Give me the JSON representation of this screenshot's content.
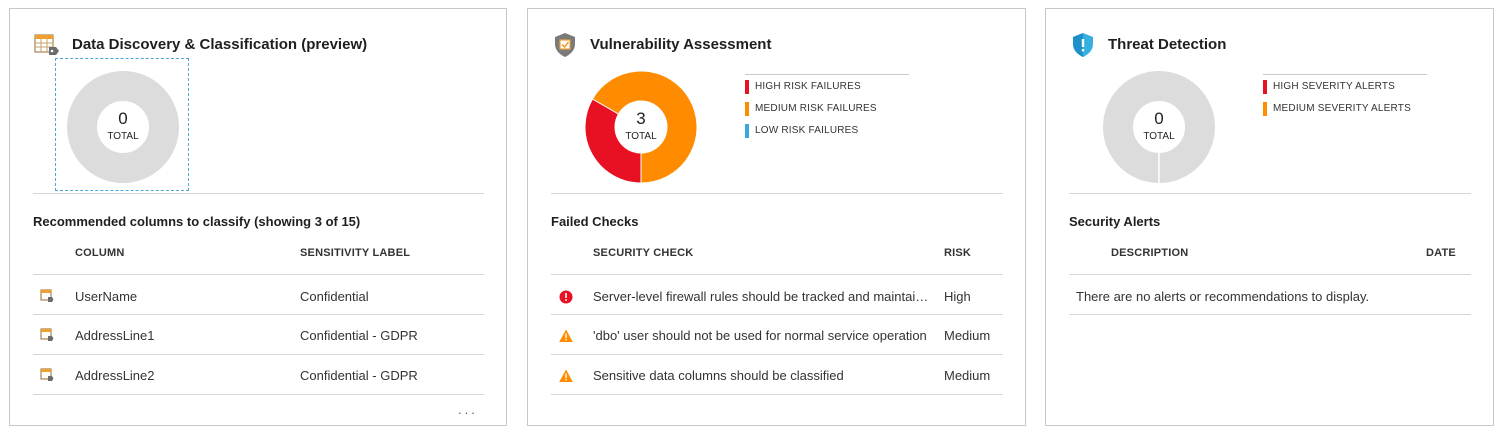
{
  "colors": {
    "high": "#e81123",
    "medium": "#ff8c00",
    "low": "#3aa8e0",
    "empty": "#dcdcdc"
  },
  "classification": {
    "title": "Data Discovery & Classification (preview)",
    "icon": "table-tag-icon",
    "donut": {
      "count": "0",
      "label": "TOTAL"
    },
    "section_title": "Recommended columns to classify (showing 3 of 15)",
    "headers": {
      "column": "COLUMN",
      "label": "SENSITIVITY LABEL"
    },
    "rows": [
      {
        "column": "UserName",
        "label": "Confidential",
        "icon": "column-icon"
      },
      {
        "column": "AddressLine1",
        "label": "Confidential - GDPR",
        "icon": "column-icon"
      },
      {
        "column": "AddressLine2",
        "label": "Confidential - GDPR",
        "icon": "column-icon"
      }
    ],
    "more": "..."
  },
  "vulnerability": {
    "title": "Vulnerability Assessment",
    "icon": "shield-check-icon",
    "donut": {
      "count": "3",
      "label": "TOTAL"
    },
    "chart_data": {
      "type": "pie",
      "categories": [
        "HIGH RISK FAILURES",
        "MEDIUM RISK FAILURES",
        "LOW RISK FAILURES"
      ],
      "values": [
        1,
        2,
        0
      ]
    },
    "legend": [
      {
        "label": "HIGH RISK FAILURES",
        "color": "#e81123"
      },
      {
        "label": "MEDIUM RISK FAILURES",
        "color": "#ff8c00"
      },
      {
        "label": "LOW RISK FAILURES",
        "color": "#3aa8e0"
      }
    ],
    "section_title": "Failed Checks",
    "headers": {
      "check": "SECURITY CHECK",
      "risk": "RISK"
    },
    "rows": [
      {
        "check": "Server-level firewall rules should be tracked and maintained at a strict minimum",
        "risk": "High",
        "icon": "error-icon"
      },
      {
        "check": "'dbo' user should not be used for normal service operation",
        "risk": "Medium",
        "icon": "warning-icon"
      },
      {
        "check": "Sensitive data columns should be classified",
        "risk": "Medium",
        "icon": "warning-icon"
      }
    ]
  },
  "threat": {
    "title": "Threat Detection",
    "icon": "shield-alert-icon",
    "donut": {
      "count": "0",
      "label": "TOTAL"
    },
    "legend": [
      {
        "label": "HIGH SEVERITY ALERTS",
        "color": "#e81123"
      },
      {
        "label": "MEDIUM SEVERITY ALERTS",
        "color": "#ff8c00"
      }
    ],
    "section_title": "Security Alerts",
    "headers": {
      "description": "DESCRIPTION",
      "date": "DATE"
    },
    "empty_message": "There are no alerts or recommendations to display."
  }
}
